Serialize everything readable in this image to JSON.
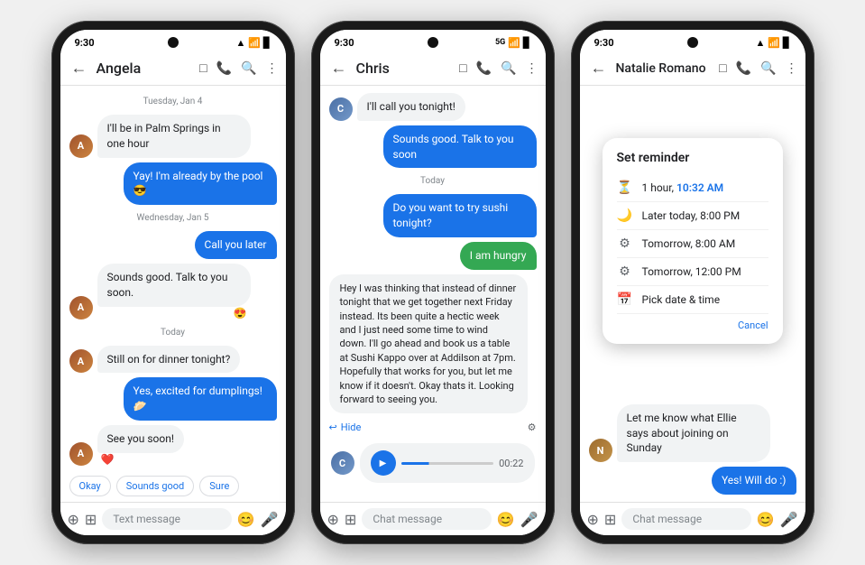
{
  "phones": [
    {
      "id": "phone-1",
      "statusBar": {
        "time": "9:30",
        "network": "▲▼",
        "icons": "▲▼ 📶 🔋"
      },
      "header": {
        "back": "←",
        "name": "Angela",
        "icons": [
          "□",
          "☎",
          "🔍",
          "⋮"
        ]
      },
      "messages": [
        {
          "type": "date",
          "text": "Tuesday, Jan 4"
        },
        {
          "type": "received",
          "avatar": "A",
          "text": "I'll be in Palm Springs in one hour"
        },
        {
          "type": "sent",
          "text": "Yay! I'm already by the pool 😎"
        },
        {
          "type": "date",
          "text": "Wednesday, Jan 5"
        },
        {
          "type": "sent",
          "text": "Call you later"
        },
        {
          "type": "received",
          "avatar": "A",
          "text": "Sounds good. Talk to you soon.",
          "reaction": "😍"
        },
        {
          "type": "date",
          "text": "Today"
        },
        {
          "type": "received",
          "avatar": "A",
          "text": "Still on for dinner tonight?"
        },
        {
          "type": "sent",
          "text": "Yes, excited for dumplings! 🥟"
        },
        {
          "type": "received",
          "avatar": "A",
          "text": "See you soon!",
          "reaction": "❤️"
        }
      ],
      "quickReplies": [
        "Okay",
        "Sounds good",
        "Sure"
      ],
      "bottomInput": "Text message"
    },
    {
      "id": "phone-2",
      "statusBar": {
        "time": "9:30",
        "network": "5G"
      },
      "header": {
        "back": "←",
        "name": "Chris",
        "icons": [
          "□",
          "☎",
          "🔍",
          "⋮"
        ]
      },
      "messages": [
        {
          "type": "received",
          "avatar": "C",
          "text": "I'll call you tonight!"
        },
        {
          "type": "sent",
          "text": "Sounds good. Talk to you soon"
        },
        {
          "type": "date",
          "text": "Today"
        },
        {
          "type": "sent",
          "text": "Do you want to try sushi tonight?"
        },
        {
          "type": "sent",
          "text": "I am hungry",
          "color": "green"
        },
        {
          "type": "long",
          "text": "Hey I was thinking that instead of dinner tonight that we get together next Friday instead. Its been quite a hectic week and I just need some time to wind down. I'll go ahead and book us a table at Sushi Kappo over at Addilson at 7pm. Hopefully that works for you, but let me know if it doesn't. Okay thats it. Looking forward to seeing you."
        },
        {
          "type": "audio",
          "time": "00:22"
        }
      ],
      "bottomInput": "Chat message"
    },
    {
      "id": "phone-3",
      "statusBar": {
        "time": "9:30"
      },
      "header": {
        "back": "←",
        "name": "Natalie Romano",
        "icons": [
          "□",
          "☎",
          "🔍",
          "⋮"
        ]
      },
      "messages": [
        {
          "type": "received",
          "avatar": "N",
          "text": "Let me know what Ellie says about joining on Sunday"
        },
        {
          "type": "sent",
          "text": "Yes! Will do :)"
        }
      ],
      "reminder": {
        "title": "Set reminder",
        "items": [
          {
            "icon": "⏳",
            "text": "1 hour, ",
            "highlight": "10:32 AM"
          },
          {
            "icon": "🌙",
            "text": "Later today, 8:00 PM"
          },
          {
            "icon": "⚙",
            "text": "Tomorrow, 8:00 AM"
          },
          {
            "icon": "⚙",
            "text": "Tomorrow, 12:00 PM"
          },
          {
            "icon": "📅",
            "text": "Pick date & time"
          }
        ],
        "cancelLabel": "Cancel"
      },
      "bottomInput": "Chat message"
    }
  ]
}
